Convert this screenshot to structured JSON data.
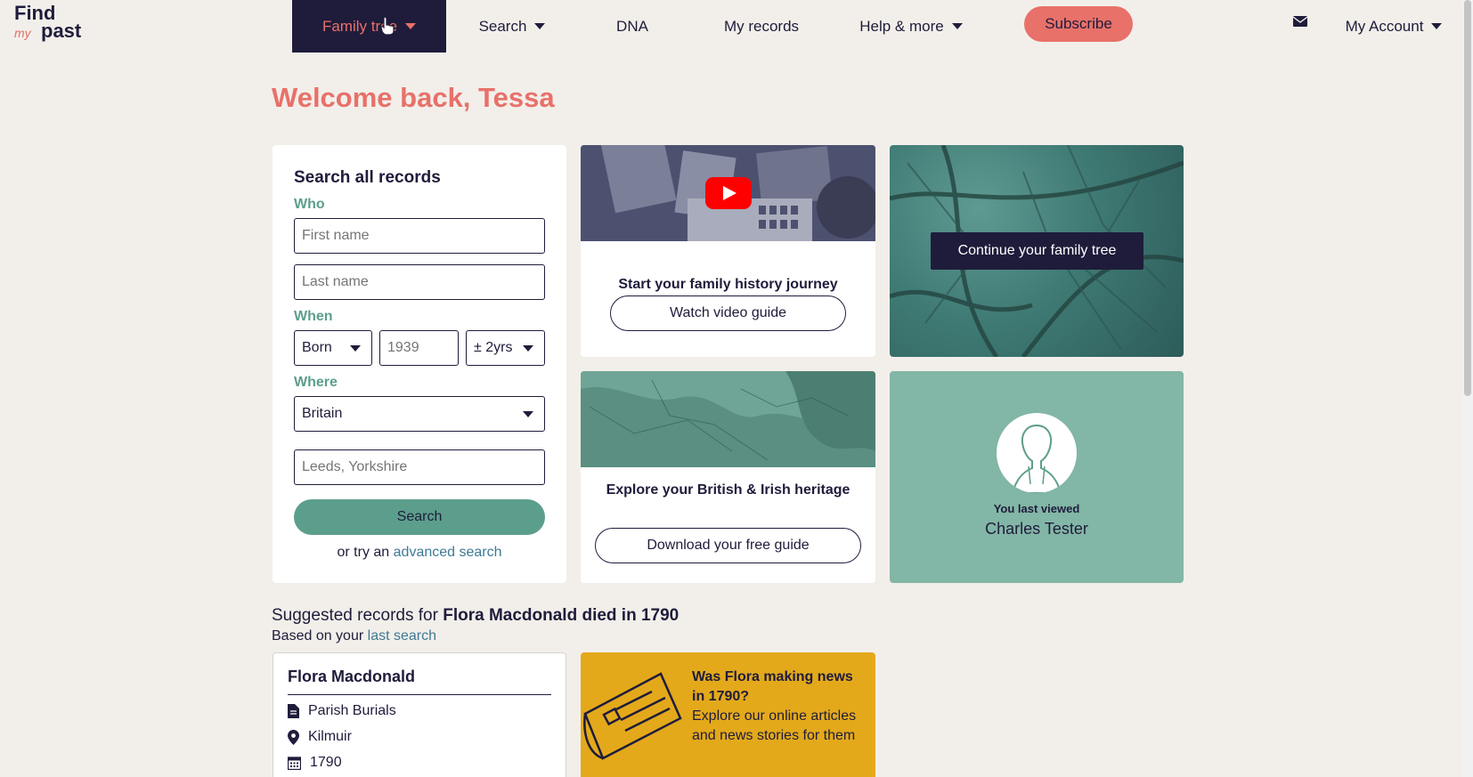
{
  "brand": {
    "line1": "Find",
    "line2": "my",
    "line3": "past"
  },
  "nav": {
    "family_tree": "Family tree",
    "search": "Search",
    "dna": "DNA",
    "my_records": "My records",
    "help": "Help & more",
    "subscribe": "Subscribe",
    "account": "My Account"
  },
  "welcome": "Welcome back, Tessa",
  "search_card": {
    "title": "Search all records",
    "who_label": "Who",
    "first_name_placeholder": "First name",
    "last_name_placeholder": "Last name",
    "when_label": "When",
    "event_value": "Born",
    "year_placeholder": "1939",
    "range_value": "± 2yrs",
    "where_label": "Where",
    "country_value": "Britain",
    "place_placeholder": "Leeds, Yorkshire",
    "search_button": "Search",
    "advanced_prefix": "or try an",
    "advanced_link": "advanced search"
  },
  "video_card": {
    "title": "Start your family history journey",
    "button": "Watch video guide"
  },
  "tree_card": {
    "button": "Continue your family tree"
  },
  "map_card": {
    "title": "Explore your British & Irish heritage",
    "button": "Download your free guide"
  },
  "last_viewed": {
    "label": "You last viewed",
    "name": "Charles Tester"
  },
  "suggested": {
    "prefix": "Suggested records for",
    "subject": "Flora Macdonald died in 1790",
    "based_prefix": "Based on your",
    "based_link": "last search"
  },
  "record": {
    "name": "Flora Macdonald",
    "type": "Parish Burials",
    "place": "Kilmuir",
    "year": "1790"
  },
  "news": {
    "title": "Was Flora making news in 1790?",
    "text": "Explore our online articles and news stories for them"
  },
  "colors": {
    "coral": "#e8716a",
    "navy": "#1f1c3b",
    "teal": "#5c9e8c",
    "mustard": "#e3a91b"
  }
}
